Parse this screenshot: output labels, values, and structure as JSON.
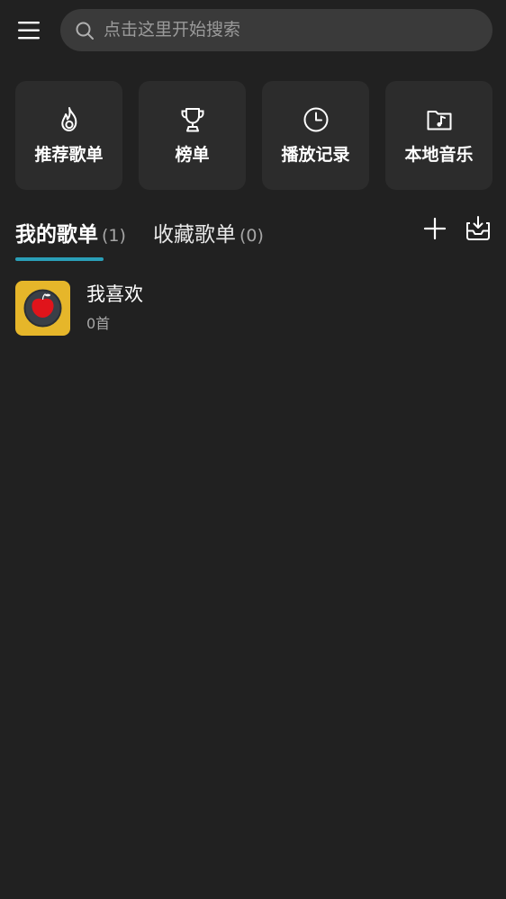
{
  "header": {
    "menu_icon": "menu-icon",
    "search": {
      "placeholder": "点击这里开始搜索",
      "icon": "search-icon"
    }
  },
  "quick_links": [
    {
      "label": "推荐歌单",
      "icon": "flame-icon"
    },
    {
      "label": "榜单",
      "icon": "trophy-icon"
    },
    {
      "label": "播放记录",
      "icon": "clock-icon"
    },
    {
      "label": "本地音乐",
      "icon": "music-folder-icon"
    }
  ],
  "tabs": [
    {
      "label": "我的歌单",
      "count": "(1)",
      "active": true
    },
    {
      "label": "收藏歌单",
      "count": "(0)",
      "active": false
    }
  ],
  "actions": {
    "add_icon": "plus-icon",
    "import_icon": "inbox-download-icon"
  },
  "playlists": [
    {
      "title": "我喜欢",
      "count": "0首",
      "cover_icon": "apple-record-icon"
    }
  ],
  "colors": {
    "background": "#212121",
    "card": "#2c2c2c",
    "search_bg": "#3a3a3a",
    "accent": "#2a9fb8",
    "cover_bg": "#e6b62a"
  }
}
